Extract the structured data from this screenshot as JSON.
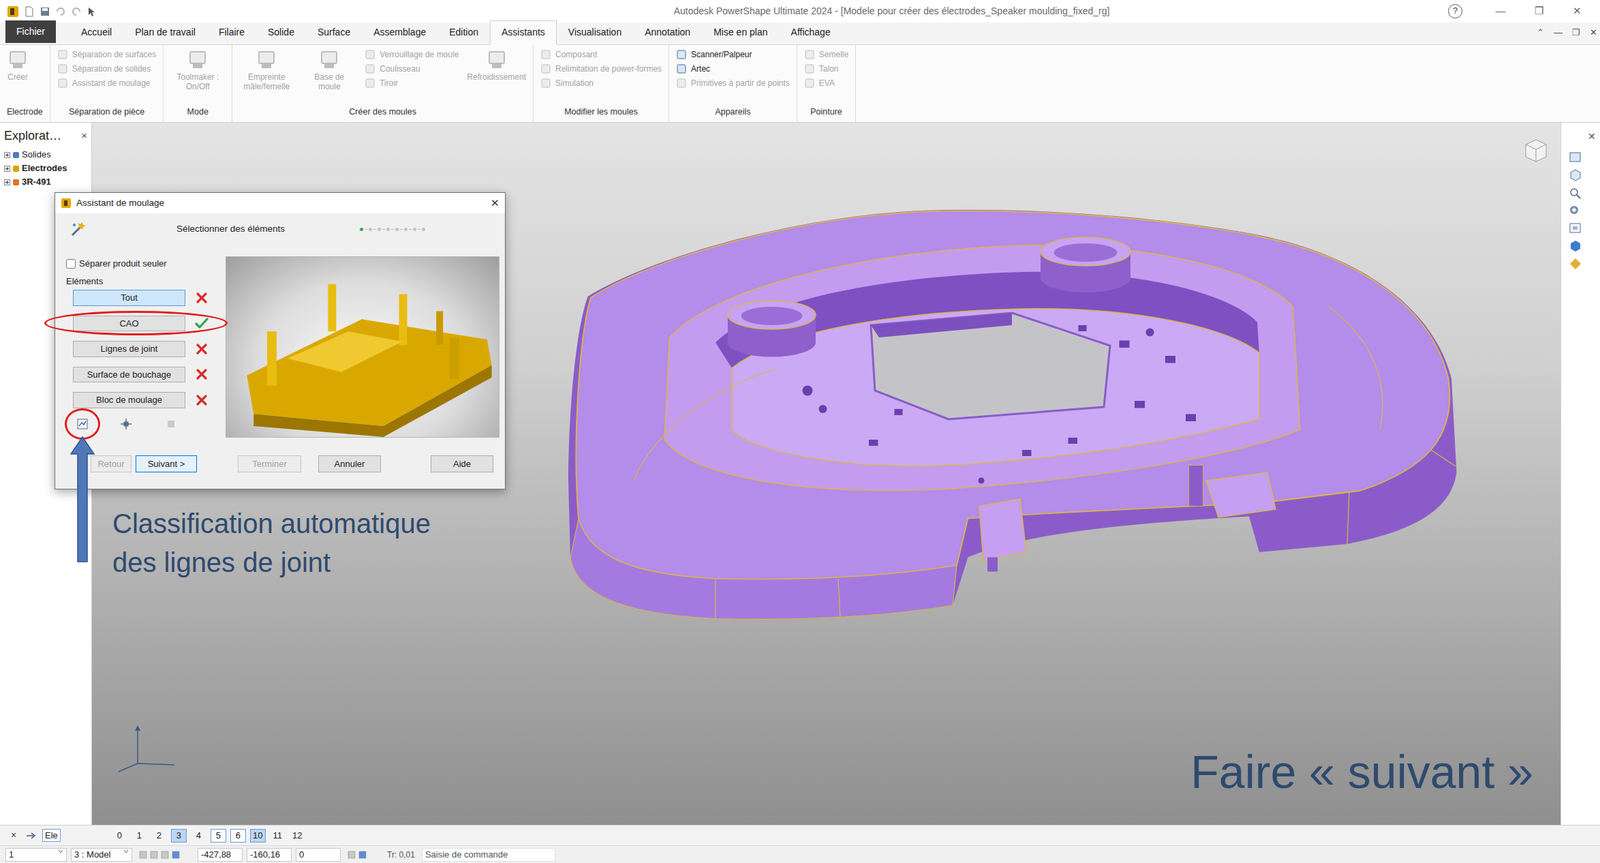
{
  "window": {
    "title": "Autodesk PowerShape Ultimate 2024 - [Modele pour créer des électrodes_Speaker moulding_fixed_rg]",
    "help": "?",
    "controls": [
      "—",
      "❐",
      "✕"
    ]
  },
  "ribbon": {
    "file": "Fichier",
    "tabs": [
      {
        "label": "Accueil",
        "selected": false
      },
      {
        "label": "Plan de travail",
        "selected": false
      },
      {
        "label": "Filaire",
        "selected": false
      },
      {
        "label": "Solide",
        "selected": false
      },
      {
        "label": "Surface",
        "selected": false
      },
      {
        "label": "Assemblage",
        "selected": false
      },
      {
        "label": "Edition",
        "selected": false
      },
      {
        "label": "Assistants",
        "selected": true
      },
      {
        "label": "Visualisation",
        "selected": false
      },
      {
        "label": "Annotation",
        "selected": false
      },
      {
        "label": "Mise en plan",
        "selected": false
      },
      {
        "label": "Affichage",
        "selected": false
      }
    ],
    "controls": [
      "⌃",
      "—",
      "❐",
      "✕"
    ],
    "groups": [
      {
        "label": "Electrode",
        "items": [
          {
            "label": "Créer",
            "kind": "large",
            "disabled": true
          }
        ]
      },
      {
        "label": "Séparation de pièce",
        "items": [
          {
            "label": "Séparation de surfaces",
            "kind": "small",
            "disabled": true
          },
          {
            "label": "Séparation de solides",
            "kind": "small",
            "disabled": true
          },
          {
            "label": "Assistant de moulage",
            "kind": "small",
            "disabled": true
          }
        ]
      },
      {
        "label": "Mode",
        "items": [
          {
            "label": "Toolmaker : On/Off",
            "kind": "large",
            "disabled": true
          }
        ]
      },
      {
        "label": "Créer des moules",
        "items": [
          {
            "label": "Empreinte mâle/femelle",
            "kind": "large",
            "disabled": true
          },
          {
            "label": "Base de moule",
            "kind": "large",
            "disabled": true
          },
          {
            "label": "Verrouillage de moule",
            "kind": "small",
            "disabled": true
          },
          {
            "label": "Coulisseau",
            "kind": "small",
            "disabled": true
          },
          {
            "label": "Tiroir",
            "kind": "small",
            "disabled": true
          },
          {
            "label": "Refroidissement",
            "kind": "large",
            "disabled": true
          }
        ]
      },
      {
        "label": "Modifier les moules",
        "items": [
          {
            "label": "Composant",
            "kind": "small",
            "disabled": true
          },
          {
            "label": "Relimitation de power-formes",
            "kind": "small",
            "disabled": true
          },
          {
            "label": "Simulation",
            "kind": "small",
            "disabled": true
          }
        ]
      },
      {
        "label": "Appareils",
        "items": [
          {
            "label": "Scanner/Palpeur",
            "kind": "small",
            "disabled": false
          },
          {
            "label": "Artec",
            "kind": "small",
            "disabled": false
          },
          {
            "label": "Primitives à partir de points",
            "kind": "small",
            "disabled": true
          }
        ]
      },
      {
        "label": "Pointure",
        "items": [
          {
            "label": "Semelle",
            "kind": "small",
            "disabled": true
          },
          {
            "label": "Talon",
            "kind": "small",
            "disabled": true
          },
          {
            "label": "EVA",
            "kind": "small",
            "disabled": true
          }
        ]
      }
    ]
  },
  "explorer": {
    "title": "Explorat…",
    "close": "×",
    "items": [
      {
        "label": "Solides",
        "bold": false
      },
      {
        "label": "Electrodes",
        "bold": true
      },
      {
        "label": "3R-491",
        "bold": true
      }
    ]
  },
  "right_panel": {
    "close": "✕"
  },
  "dialog": {
    "title": "Assistant de moulage",
    "close": "✕",
    "heading": "Sélectionner des éléments",
    "steps": [
      {
        "done": true
      },
      {
        "done": false
      },
      {
        "done": false
      },
      {
        "done": false
      },
      {
        "done": false
      },
      {
        "done": false
      },
      {
        "done": false
      },
      {
        "done": false
      }
    ],
    "checkbox": {
      "label": "Séparer produit seuler",
      "checked": false
    },
    "section": "Eléments",
    "elements": [
      {
        "label": "Tout",
        "done": false,
        "selected": true
      },
      {
        "label": "CAO",
        "done": true,
        "selected": false
      },
      {
        "label": "Lignes de joint",
        "done": false,
        "selected": false
      },
      {
        "label": "Surface de bouchage",
        "done": false,
        "selected": false
      },
      {
        "label": "Bloc de moulage",
        "done": false,
        "selected": false
      }
    ],
    "tools": [
      {
        "disabled": false
      },
      {
        "disabled": false
      },
      {
        "disabled": true
      }
    ],
    "buttons": [
      {
        "label": "Retour",
        "disabled": true,
        "default": false
      },
      {
        "label": "Suivant >",
        "disabled": false,
        "default": true
      },
      {
        "label": "Terminer",
        "disabled": true,
        "default": false
      },
      {
        "label": "Annuler",
        "disabled": false,
        "default": false
      },
      {
        "label": "Aide",
        "disabled": false,
        "default": false
      }
    ]
  },
  "annotations": {
    "callout": [
      "Classification automatique",
      "des lignes de joint"
    ],
    "instruction": "Faire « suivant »"
  },
  "layers": {
    "close": "×",
    "current": "Ele",
    "items": [
      {
        "label": "0",
        "kind": "normal"
      },
      {
        "label": "1",
        "kind": "normal"
      },
      {
        "label": "2",
        "kind": "normal"
      },
      {
        "label": "3",
        "kind": "active"
      },
      {
        "label": "4",
        "kind": "normal"
      },
      {
        "label": "5",
        "kind": "boxed"
      },
      {
        "label": "6",
        "kind": "boxed"
      },
      {
        "label": "10",
        "kind": "active"
      },
      {
        "label": "11",
        "kind": "normal"
      },
      {
        "label": "12",
        "kind": "normal"
      }
    ]
  },
  "status_bar": {
    "fields": [
      {
        "text": "1",
        "kind": "select"
      },
      {
        "text": "3 : Model",
        "kind": "select"
      },
      {
        "text": "-427,88",
        "kind": "field"
      },
      {
        "text": "-160,16",
        "kind": "field"
      },
      {
        "text": "0",
        "kind": "field"
      },
      {
        "text": "Tr: 0,01",
        "kind": "text"
      },
      {
        "text": "Saisie de commande",
        "kind": "input"
      }
    ]
  }
}
